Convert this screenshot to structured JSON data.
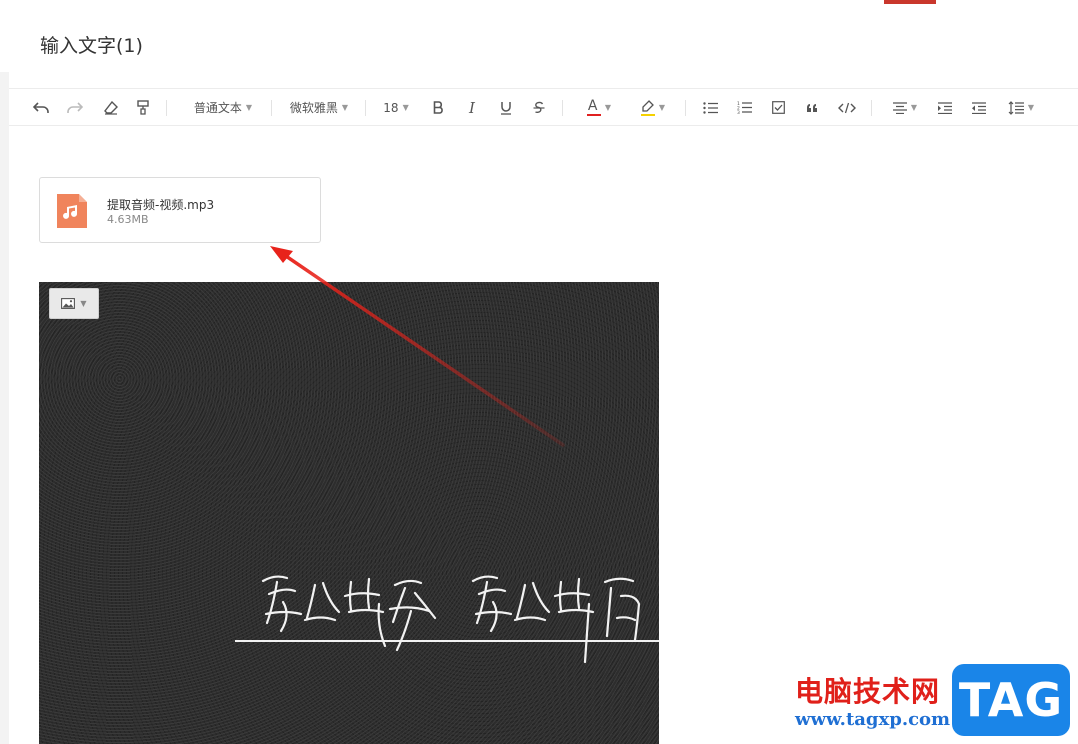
{
  "document": {
    "title": "输入文字(1)"
  },
  "toolbar": {
    "paragraph_style": "普通文本",
    "font_family": "微软雅黑",
    "font_size": "18",
    "italic": "I",
    "text_color_letter": "A",
    "colors": {
      "text_color": "#e02020",
      "highlight": "#f5d100"
    }
  },
  "attachment": {
    "file_name": "提取音频-视频.mp3",
    "file_size": "4.63MB",
    "icon": "music-file-icon",
    "icon_color": "#f0845c"
  },
  "image": {
    "menu_icon": "image-icon"
  },
  "watermark": {
    "site_name": "电脑技术网",
    "url": "www.tagxp.com",
    "badge": "TAG"
  }
}
